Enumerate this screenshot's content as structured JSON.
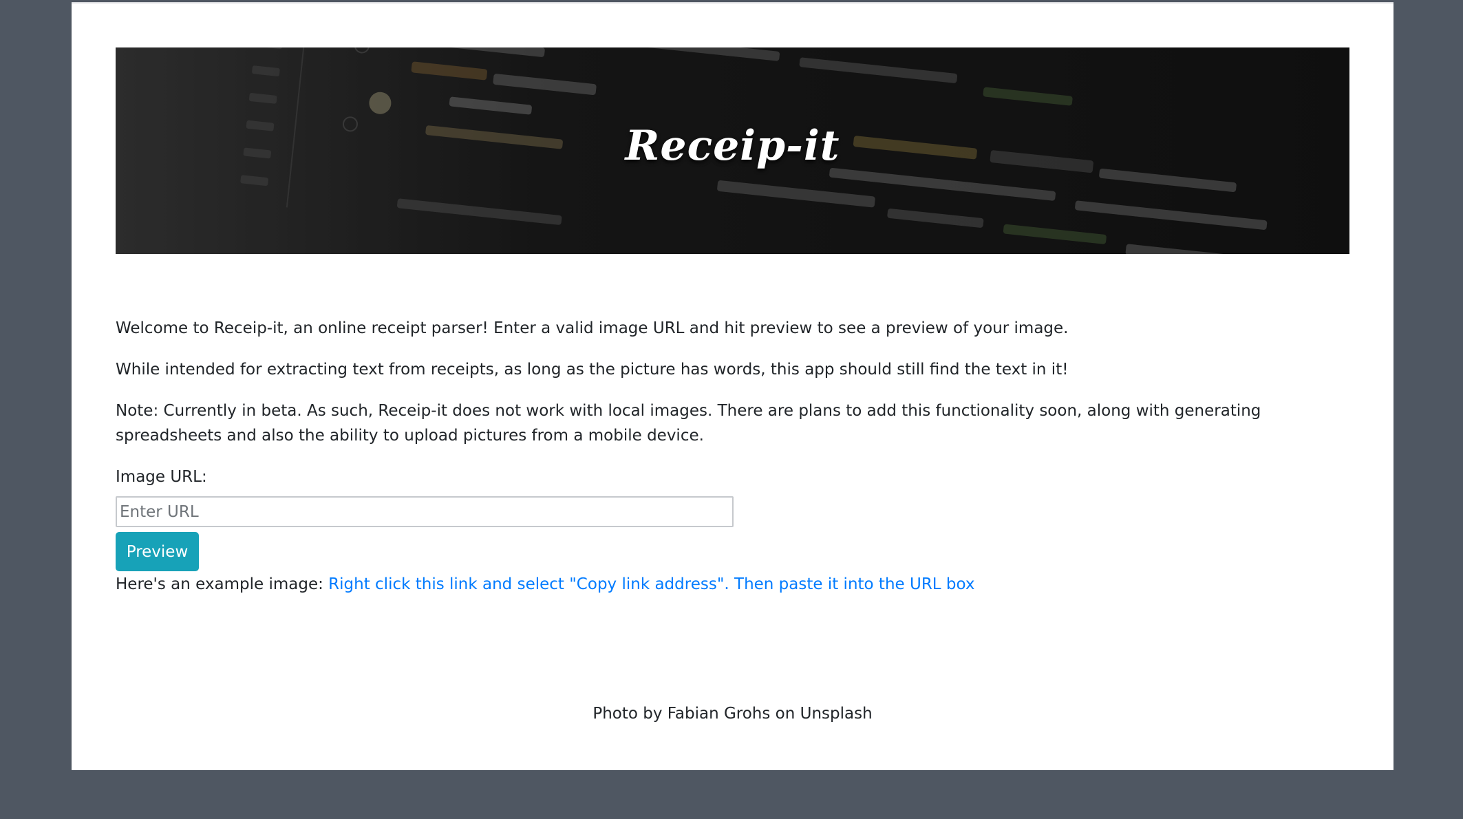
{
  "header": {
    "title": "Receip-it"
  },
  "intro": {
    "welcome": "Welcome to Receip-it, an online receipt parser! Enter a valid image URL and hit preview to see a preview of your image.",
    "intended": "While intended for extracting text from receipts, as long as the picture has words, this app should still find the text in it!",
    "note": "Note: Currently in beta. As such, Receip-it does not work with local images. There are plans to add this functionality soon, along with generating spreadsheets and also the ability to upload pictures from a mobile device."
  },
  "form": {
    "label": "Image URL:",
    "placeholder": "Enter URL",
    "value": "",
    "button_label": "Preview"
  },
  "example": {
    "prefix": "Here's an example image: ",
    "link_text": "Right click this link and select \"Copy link address\". Then paste it into the URL box"
  },
  "footer": {
    "credit": "Photo by Fabian Grohs on Unsplash"
  },
  "colors": {
    "page_background": "#4f5762",
    "card_background": "#ffffff",
    "button": "#17a2b8",
    "link": "#007bff",
    "text": "#212529"
  }
}
